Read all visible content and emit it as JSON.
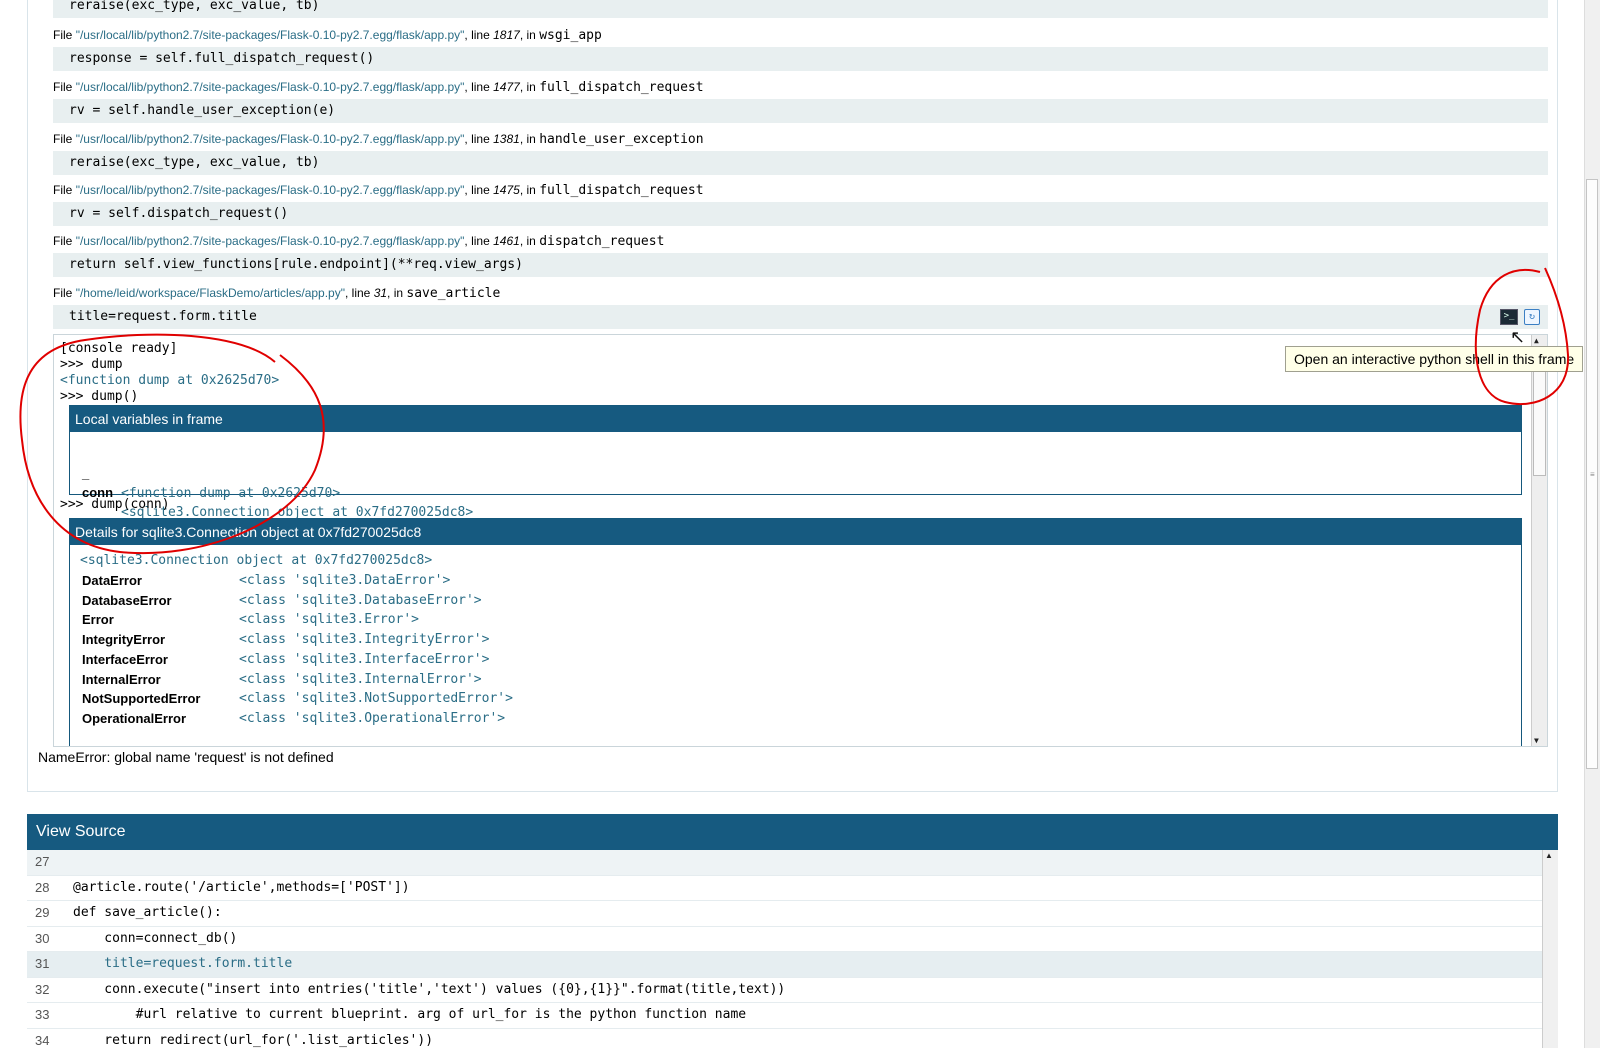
{
  "traceback": {
    "top_code": "reraise(exc_type, exc_value, tb)",
    "frames": [
      {
        "file_prefix": "File",
        "filename": "\"/usr/local/lib/python2.7/site-packages/Flask-0.10-py2.7.egg/flask/app.py\"",
        "line_label": ", line",
        "lineno": "1817",
        "in_label": ", in",
        "function": "wsgi_app",
        "code": "response = self.full_dispatch_request()"
      },
      {
        "file_prefix": "File",
        "filename": "\"/usr/local/lib/python2.7/site-packages/Flask-0.10-py2.7.egg/flask/app.py\"",
        "line_label": ", line",
        "lineno": "1477",
        "in_label": ", in",
        "function": "full_dispatch_request",
        "code": "rv = self.handle_user_exception(e)"
      },
      {
        "file_prefix": "File",
        "filename": "\"/usr/local/lib/python2.7/site-packages/Flask-0.10-py2.7.egg/flask/app.py\"",
        "line_label": ", line",
        "lineno": "1381",
        "in_label": ", in",
        "function": "handle_user_exception",
        "code": "reraise(exc_type, exc_value, tb)"
      },
      {
        "file_prefix": "File",
        "filename": "\"/usr/local/lib/python2.7/site-packages/Flask-0.10-py2.7.egg/flask/app.py\"",
        "line_label": ", line",
        "lineno": "1475",
        "in_label": ", in",
        "function": "full_dispatch_request",
        "code": "rv = self.dispatch_request()"
      },
      {
        "file_prefix": "File",
        "filename": "\"/usr/local/lib/python2.7/site-packages/Flask-0.10-py2.7.egg/flask/app.py\"",
        "line_label": ", line",
        "lineno": "1461",
        "in_label": ", in",
        "function": "dispatch_request",
        "code": "return self.view_functions[rule.endpoint](**req.view_args)"
      },
      {
        "file_prefix": "File",
        "filename": "\"/home/leid/workspace/FlaskDemo/articles/app.py\"",
        "line_label": ", line",
        "lineno": "31",
        "in_label": ", in",
        "function": "save_article",
        "code": "title=request.form.title"
      }
    ],
    "tooltip": "Open an interactive python shell in this frame",
    "icons": {
      "console": "terminal-icon",
      "source": "view-source-icon"
    }
  },
  "console": {
    "lines": [
      "[console ready]",
      ">>> dump",
      "<function dump at 0x2625d70>",
      ">>> dump()"
    ],
    "locals_box": {
      "title": "Local variables in frame",
      "rows": [
        {
          "key": "_",
          "value": "<function dump at 0x2625d70>"
        },
        {
          "key": "conn",
          "value": "<sqlite3.Connection object at 0x7fd270025dc8>"
        }
      ]
    },
    "prompt2": ">>> dump(conn)",
    "details_box": {
      "title": "Details for sqlite3.Connection object at 0x7fd270025dc8",
      "repr": "<sqlite3.Connection object at 0x7fd270025dc8>",
      "rows": [
        {
          "key": "DataError",
          "value": "<class 'sqlite3.DataError'>"
        },
        {
          "key": "DatabaseError",
          "value": "<class 'sqlite3.DatabaseError'>"
        },
        {
          "key": "Error",
          "value": "<class 'sqlite3.Error'>"
        },
        {
          "key": "IntegrityError",
          "value": "<class 'sqlite3.IntegrityError'>"
        },
        {
          "key": "InterfaceError",
          "value": "<class 'sqlite3.InterfaceError'>"
        },
        {
          "key": "InternalError",
          "value": "<class 'sqlite3.InternalError'>"
        },
        {
          "key": "NotSupportedError",
          "value": "<class 'sqlite3.NotSupportedError'>"
        },
        {
          "key": "OperationalError",
          "value": "<class 'sqlite3.OperationalError'>"
        }
      ]
    }
  },
  "error_message": "NameError: global name 'request' is not defined",
  "view_source": {
    "title": "View Source",
    "lines": [
      {
        "n": "27",
        "code": ""
      },
      {
        "n": "28",
        "code": "@article.route('/article',methods=['POST'])"
      },
      {
        "n": "29",
        "code": "def save_article():"
      },
      {
        "n": "30",
        "code": "    conn=connect_db()"
      },
      {
        "n": "31",
        "code": "    title=request.form.title"
      },
      {
        "n": "32",
        "code": "    conn.execute(\"insert into entries('title','text') values ({0},{1}}\".format(title,text))"
      },
      {
        "n": "33",
        "code": "        #url relative to current blueprint. arg of url_for is the python function name"
      },
      {
        "n": "34",
        "code": "    return redirect(url_for('.list_articles'))"
      }
    ],
    "current_line": "31"
  },
  "colors": {
    "header_bg": "#165a80",
    "code_bg": "#e8eff0",
    "link": "#2a6d86",
    "annotation": "#e00000"
  }
}
